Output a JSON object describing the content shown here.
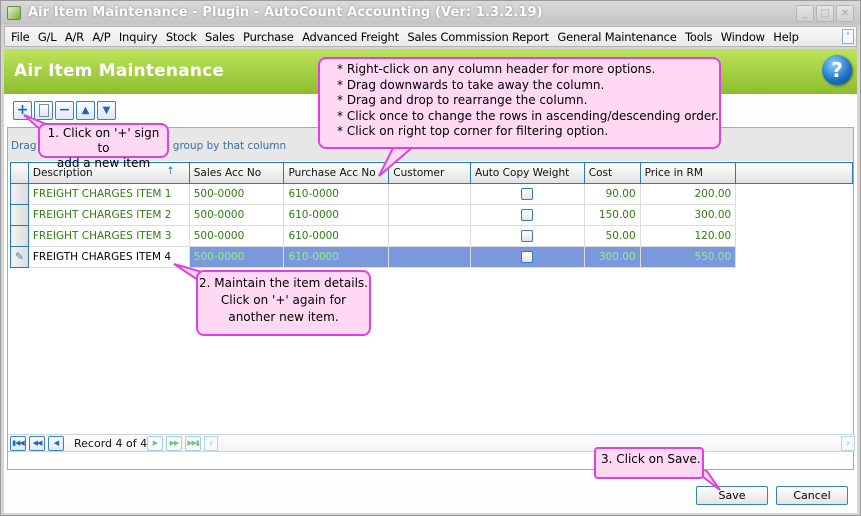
{
  "window": {
    "title": "Air Item Maintenance - Plugin  - AutoCount Accounting (Ver: 1.3.2.19)",
    "controls": [
      "minimize",
      "maximize",
      "close"
    ]
  },
  "menubar": {
    "items": [
      "File",
      "G/L",
      "A/R",
      "A/P",
      "Inquiry",
      "Stock",
      "Sales",
      "Purchase",
      "Advanced Freight",
      "Sales Commission Report",
      "General Maintenance",
      "Tools",
      "Window",
      "Help"
    ]
  },
  "header": {
    "title": "Air Item Maintenance",
    "help_icon": "question-mark-icon"
  },
  "toolbar": {
    "buttons": [
      {
        "name": "add",
        "icon": "plus-icon"
      },
      {
        "name": "edit",
        "icon": "document-icon"
      },
      {
        "name": "delete",
        "icon": "minus-icon"
      },
      {
        "name": "move-up",
        "icon": "arrow-up-icon"
      },
      {
        "name": "move-down",
        "icon": "arrow-down-icon"
      }
    ]
  },
  "grid": {
    "group_hint": "Drag a column header here to group by that column",
    "group_hint_visible_prefix": "Drag a",
    "group_hint_visible_suffix": "up by that column",
    "columns": [
      "Description",
      "Sales Acc No",
      "Purchase Acc No",
      "Customer",
      "Auto Copy Weight",
      "Cost",
      "Price in RM"
    ],
    "sort_indicator": "↑",
    "rows": [
      {
        "description": "FREIGHT CHARGES ITEM 1",
        "sales_acc": "500-0000",
        "purchase_acc": "610-0000",
        "customer": "",
        "auto_copy_weight": false,
        "cost": "90.00",
        "price": "200.00",
        "selected": false
      },
      {
        "description": "FREIGHT CHARGES ITEM 2",
        "sales_acc": "500-0000",
        "purchase_acc": "610-0000",
        "customer": "",
        "auto_copy_weight": false,
        "cost": "150.00",
        "price": "300.00",
        "selected": false
      },
      {
        "description": "FREIGHT CHARGES ITEM 3",
        "sales_acc": "500-0000",
        "purchase_acc": "610-0000",
        "customer": "",
        "auto_copy_weight": false,
        "cost": "50.00",
        "price": "120.00",
        "selected": false
      },
      {
        "description": "FREIGTH CHARGES ITEM 4",
        "sales_acc": "500-0000",
        "purchase_acc": "610-0000",
        "customer": "",
        "auto_copy_weight": false,
        "cost": "300.00",
        "price": "550.00",
        "selected": true
      }
    ]
  },
  "navigator": {
    "record_text": "Record 4 of 4",
    "current": 4,
    "total": 4
  },
  "buttons": {
    "save": "Save",
    "cancel": "Cancel"
  },
  "callouts": {
    "step1": [
      "1. Click on '+' sign to",
      "add a new item"
    ],
    "tips": [
      "* Right-click on any column header for more options.",
      "* Drag downwards to take away the column.",
      "* Drag and drop to rearrange the column.",
      "* Click once to change the rows in ascending/descending order.",
      "* Click on right top corner for filtering option."
    ],
    "step2": [
      "2. Maintain the item details.",
      "Click on '+' again for",
      "another new item."
    ],
    "step3": "3. Click on Save."
  },
  "colors": {
    "header_green_top": "#bde35c",
    "header_green_bottom": "#8dbd2e",
    "callout_fill": "#ffd9f4",
    "callout_border": "#e040e0",
    "row_text_green": "#2e7d10",
    "selected_row": "#7c98dc",
    "grid_border_blue": "#2a7ab8"
  }
}
